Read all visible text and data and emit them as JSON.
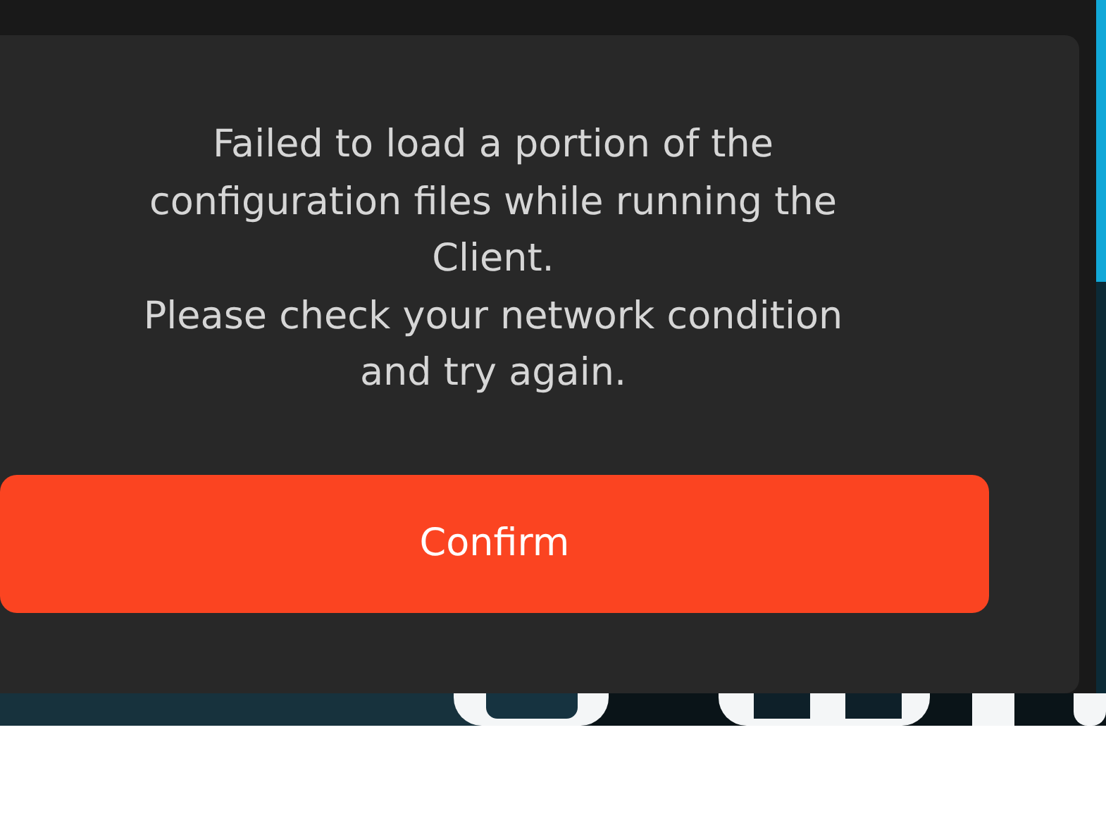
{
  "dialog": {
    "message": "Failed to load a portion of the\nconfiguration files while running the\nClient.\nPlease check your network condition\nand try again.",
    "buttons": [
      {
        "label": "Confirm",
        "kind": "primary"
      }
    ]
  }
}
